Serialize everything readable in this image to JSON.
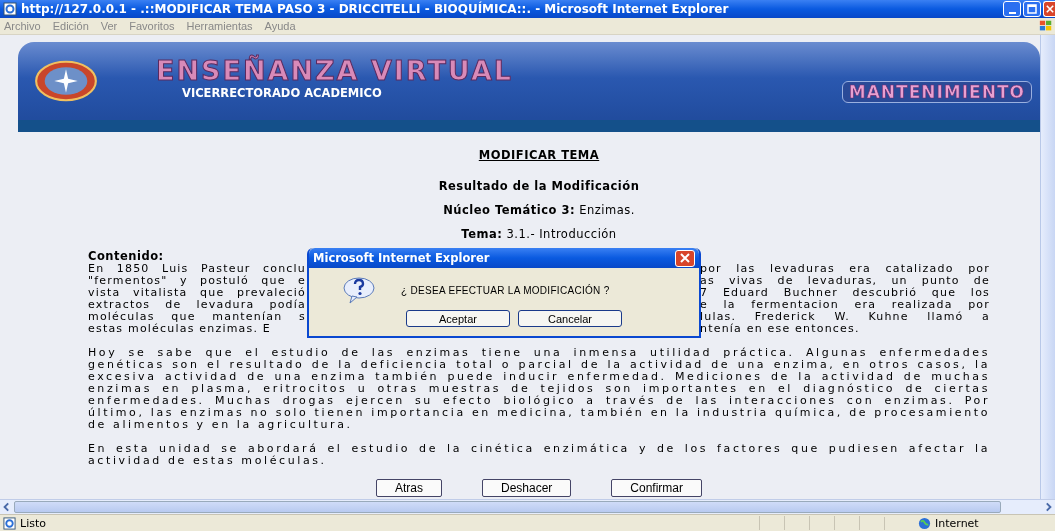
{
  "window": {
    "title": "http://127.0.0.1 - .::MODIFICAR TEMA PASO 3 - DRICCITELLI - BIOQUÍMICA::. - Microsoft Internet Explorer"
  },
  "menu": [
    "Archivo",
    "Edición",
    "Ver",
    "Favoritos",
    "Herramientas",
    "Ayuda"
  ],
  "banner": {
    "title": "ENSEÑANZA VIRTUAL",
    "subtitle": "VICERRECTORADO ACADEMICO",
    "section": "MANTENIMIENTO"
  },
  "page": {
    "heading": "MODIFICAR TEMA",
    "result": "Resultado de la Modificación",
    "nucleo": "**Núcleo Temático 3:** Enzimas.",
    "tema": "**Tema:** 3.1.- Introducción",
    "content_label": "Contenido:",
    "first_paragraph_lines": [
      {
        "left": "En 1850 Luis Pasteur conclu",
        "right": "por las levaduras era catalizado por"
      },
      {
        "left": "\"fermentos\" y postuló que e",
        "right": "as vivas de levaduras, un punto de"
      },
      {
        "left": "vista vitalista que prevaleció",
        "right": "7 Eduard Buchner descubrió que los"
      },
      {
        "left": "extractos de levadura podía",
        "right": "e la fermentacion era realizada por"
      },
      {
        "left": "moléculas que mantenían s",
        "right": "lulas. Frederick W. Kuhne llamó a"
      },
      {
        "left": "estas moléculas enzimas. E",
        "right": "ntenía en ese entonces."
      }
    ],
    "paragraphs": [
      "Hoy se sabe que el estudio de las enzimas tiene una inmensa utilidad práctica. Algunas enfermedades genéticas son el resultado de la deficiencia total o parcial de la actividad de una enzima, en otros casos, la excesiva actividad de una enzima también puede inducir enfermedad. Mediciones de la actividad de muchas enzimas en plasma, eritrocitos u otras muestras de tejidos son importantes en el diagnóstico de ciertas enfermedades. Muchas drogas ejercen su efecto biológico a través de las interacciones con enzimas. Por último, las enzimas no solo tienen importancia en medicina, también en la industria química, de procesamiento de alimentos y en la agricultura.",
      "En esta unidad se abordará el estudio de la cinética enzimática y de los factores que pudiesen afectar la actividad de estas moléculas."
    ],
    "buttons": [
      "Atras",
      "Deshacer",
      "Confirmar"
    ]
  },
  "dialog": {
    "title": "Microsoft Internet Explorer",
    "message": "¿ DESEA EFECTUAR LA MODIFICACIÓN ?",
    "buttons": [
      "Aceptar",
      "Cancelar"
    ]
  },
  "status_bar": {
    "text": "Listo",
    "zone": "Internet"
  }
}
